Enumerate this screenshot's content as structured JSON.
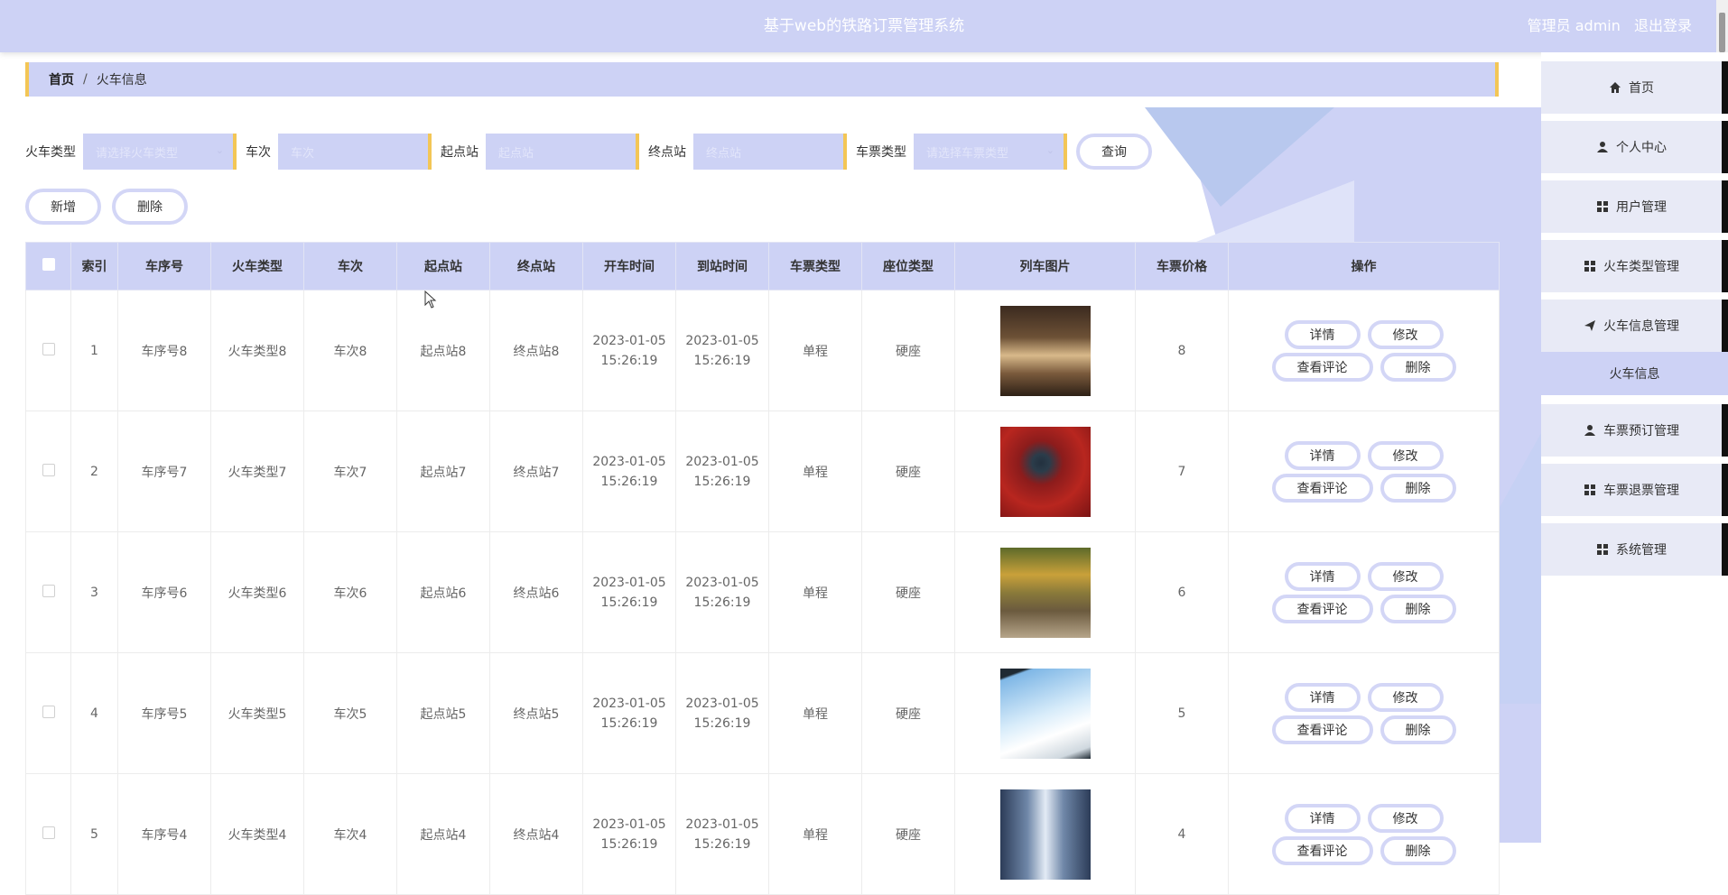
{
  "header": {
    "title": "基于web的铁路订票管理系统",
    "user_label": "管理员 admin",
    "logout": "退出登录"
  },
  "breadcrumb": {
    "home": "首页",
    "separator": "/",
    "current": "火车信息"
  },
  "search": {
    "fields": [
      {
        "label": "火车类型",
        "placeholder": "请选择火车类型",
        "type": "select"
      },
      {
        "label": "车次",
        "placeholder": "车次",
        "type": "input"
      },
      {
        "label": "起点站",
        "placeholder": "起点站",
        "type": "input"
      },
      {
        "label": "终点站",
        "placeholder": "终点站",
        "type": "input"
      },
      {
        "label": "车票类型",
        "placeholder": "请选择车票类型",
        "type": "select"
      }
    ],
    "query_button": "查询"
  },
  "actions": {
    "add": "新增",
    "delete": "删除"
  },
  "table": {
    "columns": [
      "索引",
      "车序号",
      "火车类型",
      "车次",
      "起点站",
      "终点站",
      "开车时间",
      "到站时间",
      "车票类型",
      "座位类型",
      "列车图片",
      "车票价格",
      "操作"
    ],
    "rows": [
      {
        "index": "1",
        "seq": "车序号8",
        "train_type": "火车类型8",
        "train_no": "车次8",
        "from": "起点站8",
        "to": "终点站8",
        "depart_date": "2023-01-05",
        "depart_time": "15:26:19",
        "arrive_date": "2023-01-05",
        "arrive_time": "15:26:19",
        "ticket_type": "单程",
        "seat_type": "硬座",
        "price": "8",
        "image": "train-interior"
      },
      {
        "index": "2",
        "seq": "车序号7",
        "train_type": "火车类型7",
        "train_no": "车次7",
        "from": "起点站7",
        "to": "终点站7",
        "depart_date": "2023-01-05",
        "depart_time": "15:26:19",
        "arrive_date": "2023-01-05",
        "arrive_time": "15:26:19",
        "ticket_type": "单程",
        "seat_type": "硬座",
        "price": "7",
        "image": "train-red-landscape"
      },
      {
        "index": "3",
        "seq": "车序号6",
        "train_type": "火车类型6",
        "train_no": "车次6",
        "from": "起点站6",
        "to": "终点站6",
        "depart_date": "2023-01-05",
        "depart_time": "15:26:19",
        "arrive_date": "2023-01-05",
        "arrive_time": "15:26:19",
        "ticket_type": "单程",
        "seat_type": "硬座",
        "price": "6",
        "image": "train-forest-track"
      },
      {
        "index": "4",
        "seq": "车序号5",
        "train_type": "火车类型5",
        "train_no": "车次5",
        "from": "起点站5",
        "to": "终点站5",
        "depart_date": "2023-01-05",
        "depart_time": "15:26:19",
        "arrive_date": "2023-01-05",
        "arrive_time": "15:26:19",
        "ticket_type": "单程",
        "seat_type": "硬座",
        "price": "5",
        "image": "bullet-train-tablet"
      },
      {
        "index": "5",
        "seq": "车序号4",
        "train_type": "火车类型4",
        "train_no": "车次4",
        "from": "起点站4",
        "to": "终点站4",
        "depart_date": "2023-01-05",
        "depart_time": "15:26:19",
        "arrive_date": "2023-01-05",
        "arrive_time": "15:26:19",
        "ticket_type": "单程",
        "seat_type": "硬座",
        "price": "4",
        "image": "train-aisle"
      }
    ],
    "row_buttons": {
      "detail": "详情",
      "edit": "修改",
      "comments": "查看评论",
      "delete": "删除"
    }
  },
  "sidebar": {
    "items": [
      {
        "label": "首页",
        "icon": "home-icon"
      },
      {
        "label": "个人中心",
        "icon": "user-icon"
      },
      {
        "label": "用户管理",
        "icon": "grid-icon"
      },
      {
        "label": "火车类型管理",
        "icon": "grid-icon"
      },
      {
        "label": "火车信息管理",
        "icon": "send-icon"
      },
      {
        "label": "车票预订管理",
        "icon": "user-icon"
      },
      {
        "label": "车票退票管理",
        "icon": "grid-icon"
      },
      {
        "label": "系统管理",
        "icon": "grid-icon"
      }
    ],
    "active_sub": "火车信息"
  },
  "colors": {
    "primary": "#cdd2f5",
    "accent": "#f3c656",
    "border": "#d3d6f6"
  }
}
